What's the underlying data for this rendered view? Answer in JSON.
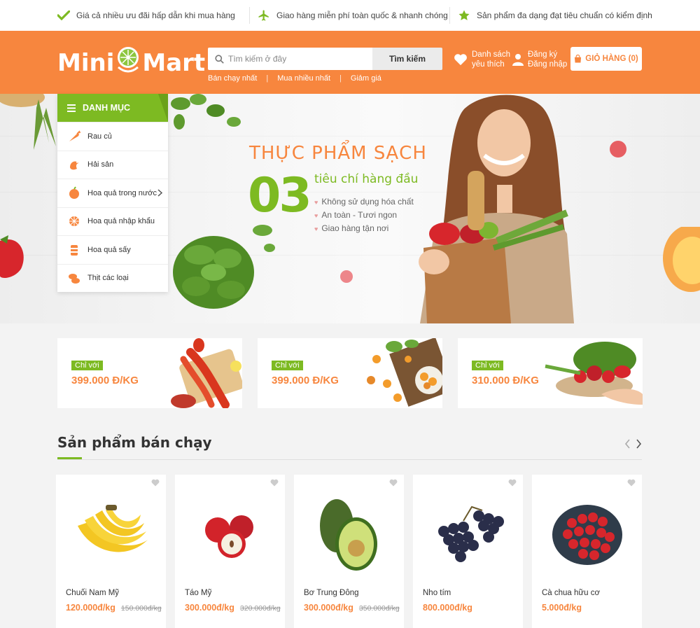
{
  "benefits": [
    {
      "icon": "check-icon",
      "text": "Giá cả nhiều ưu đãi hấp dẫn khi mua hàng"
    },
    {
      "icon": "plane-icon",
      "text": "Giao hàng miễn phí toàn quốc & nhanh chóng"
    },
    {
      "icon": "star-icon",
      "text": "Sản phẩm đa dạng đạt tiêu chuẩn có kiểm định"
    }
  ],
  "header": {
    "logo_left": "Mini",
    "logo_right": "Mart",
    "search_placeholder": "Tìm kiếm ở đây",
    "search_button": "Tìm kiếm",
    "quick_links": [
      "Bán chạy nhất",
      "Mua nhiều nhất",
      "Giảm giá"
    ],
    "wishlist_line1": "Danh sách",
    "wishlist_line2": "yêu thích",
    "account_line1": "Đăng ký",
    "account_line2": "Đăng nhập",
    "cart_label": "GIỎ HÀNG (0)"
  },
  "categories": {
    "title": "DANH MỤC",
    "items": [
      {
        "label": "Rau củ",
        "icon": "vegetable-icon"
      },
      {
        "label": "Hải sản",
        "icon": "seafood-icon"
      },
      {
        "label": "Hoa quả trong nước",
        "icon": "fruit-icon"
      },
      {
        "label": "Hoa quả nhập khẩu",
        "icon": "imported-fruit-icon"
      },
      {
        "label": "Hoa quả sấy",
        "icon": "dried-fruit-icon"
      },
      {
        "label": "Thịt các loại",
        "icon": "meat-icon"
      }
    ]
  },
  "hero": {
    "headline": "THỰC PHẨM SẠCH",
    "number": "03",
    "subtitle": "tiêu chí hàng đầu",
    "points": [
      "Không sử dụng hóa chất",
      "An toàn - Tươi ngon",
      "Giao hàng tận nơi"
    ]
  },
  "promos": [
    {
      "tag": "Chỉ với",
      "price": "399.000 Đ/KG"
    },
    {
      "tag": "Chỉ với",
      "price": "399.000 Đ/KG"
    },
    {
      "tag": "Chỉ với",
      "price": "310.000 Đ/KG"
    }
  ],
  "bestsellers": {
    "title": "Sản phẩm bán chạy",
    "products": [
      {
        "name": "Chuối Nam Mỹ",
        "price": "120.000đ/kg",
        "old_price": "150.000đ/kg"
      },
      {
        "name": "Táo Mỹ",
        "price": "300.000đ/kg",
        "old_price": "320.000đ/kg"
      },
      {
        "name": "Bơ Trung Đông",
        "price": "300.000đ/kg",
        "old_price": "350.000đ/kg"
      },
      {
        "name": "Nho tím",
        "price": "800.000đ/kg",
        "old_price": ""
      },
      {
        "name": "Cà chua hữu cơ",
        "price": "5.000đ/kg",
        "old_price": ""
      }
    ]
  },
  "colors": {
    "brand_orange": "#f7863e",
    "brand_green": "#7dba22"
  }
}
